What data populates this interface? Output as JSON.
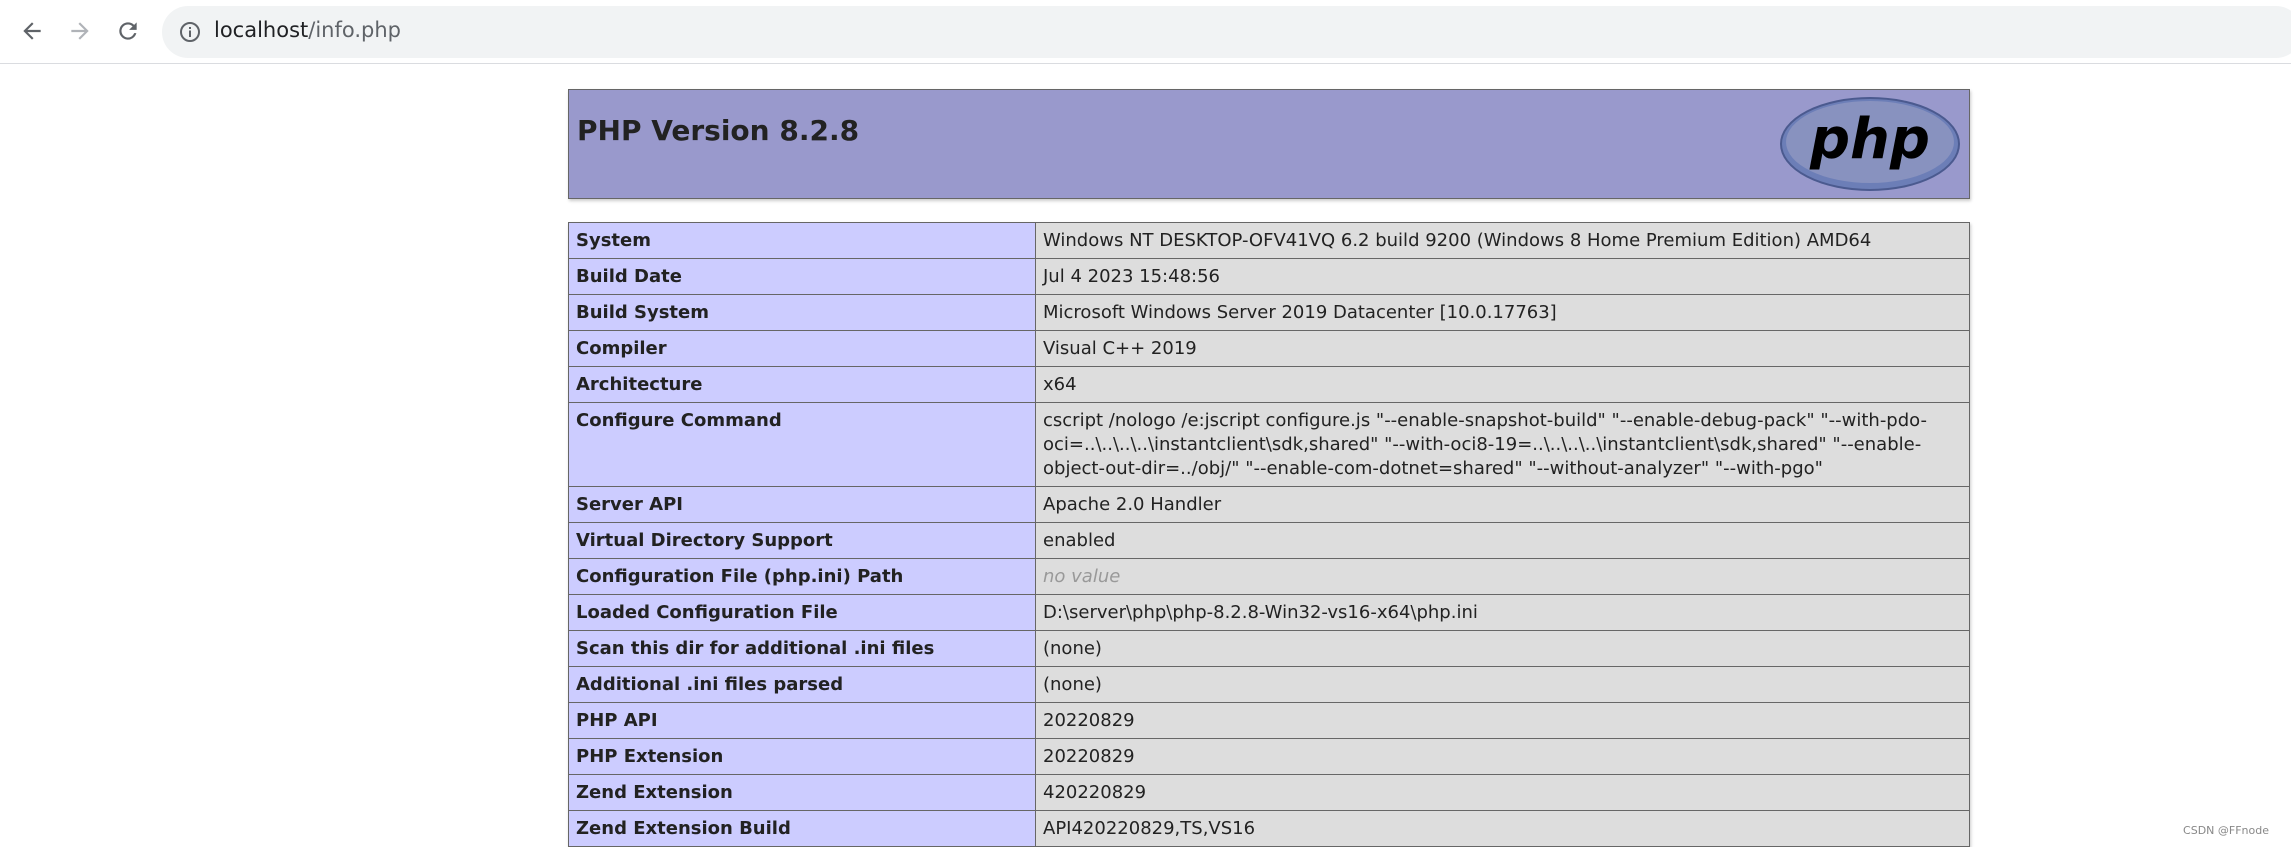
{
  "browser": {
    "url_host": "localhost",
    "url_path": "/info.php"
  },
  "header": {
    "title": "PHP Version 8.2.8",
    "logo_text": "php"
  },
  "rows": [
    {
      "label": "System",
      "value": "Windows NT DESKTOP-OFV41VQ 6.2 build 9200 (Windows 8 Home Premium Edition) AMD64"
    },
    {
      "label": "Build Date",
      "value": "Jul 4 2023 15:48:56"
    },
    {
      "label": "Build System",
      "value": "Microsoft Windows Server 2019 Datacenter [10.0.17763]"
    },
    {
      "label": "Compiler",
      "value": "Visual C++ 2019"
    },
    {
      "label": "Architecture",
      "value": "x64"
    },
    {
      "label": "Configure Command",
      "value": "cscript /nologo /e:jscript configure.js \"--enable-snapshot-build\" \"--enable-debug-pack\" \"--with-pdo-oci=..\\..\\..\\..\\instantclient\\sdk,shared\" \"--with-oci8-19=..\\..\\..\\..\\instantclient\\sdk,shared\" \"--enable-object-out-dir=../obj/\" \"--enable-com-dotnet=shared\" \"--without-analyzer\" \"--with-pgo\""
    },
    {
      "label": "Server API",
      "value": "Apache 2.0 Handler"
    },
    {
      "label": "Virtual Directory Support",
      "value": "enabled"
    },
    {
      "label": "Configuration File (php.ini) Path",
      "value": "no value"
    },
    {
      "label": "Loaded Configuration File",
      "value": "D:\\server\\php\\php-8.2.8-Win32-vs16-x64\\php.ini"
    },
    {
      "label": "Scan this dir for additional .ini files",
      "value": "(none)"
    },
    {
      "label": "Additional .ini files parsed",
      "value": "(none)"
    },
    {
      "label": "PHP API",
      "value": "20220829"
    },
    {
      "label": "PHP Extension",
      "value": "20220829"
    },
    {
      "label": "Zend Extension",
      "value": "420220829"
    },
    {
      "label": "Zend Extension Build",
      "value": "API420220829,TS,VS16"
    }
  ],
  "watermark": "CSDN @FFnode"
}
